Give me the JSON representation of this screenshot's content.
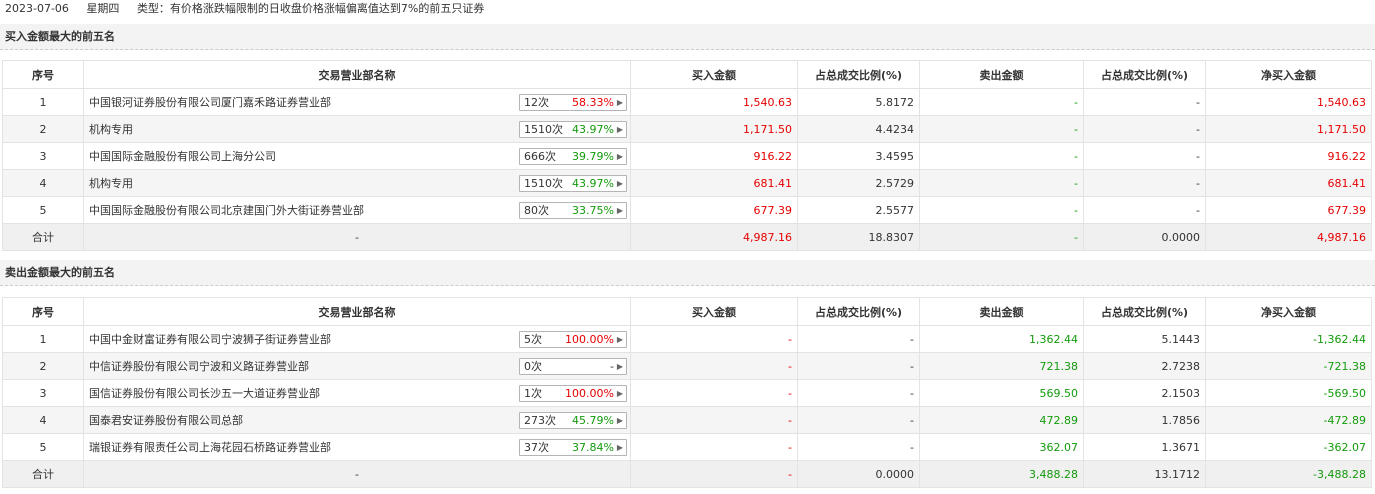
{
  "info": {
    "date": "2023-07-06",
    "weekday": "星期四",
    "type_text": "类型：有价格涨跌幅限制的日收盘价格涨幅偏离值达到7%的前五只证券"
  },
  "buy_section": {
    "title": "买入金额最大的前五名",
    "headers": [
      "序号",
      "交易营业部名称",
      "买入金额",
      "占总成交比例(%)",
      "卖出金额",
      "占总成交比例(%)",
      "净买入金额"
    ],
    "rows": [
      {
        "idx": "1",
        "name": "中国银河证券股份有限公司厦门嘉禾路证券营业部",
        "count": "12次",
        "rate": "58.33%",
        "rate_color": "red",
        "buy": "1,540.63",
        "buy_pct": "5.8172",
        "sell": "-",
        "sell_pct": "-",
        "net": "1,540.63"
      },
      {
        "idx": "2",
        "name": "机构专用",
        "count": "1510次",
        "rate": "43.97%",
        "rate_color": "green",
        "buy": "1,171.50",
        "buy_pct": "4.4234",
        "sell": "-",
        "sell_pct": "-",
        "net": "1,171.50"
      },
      {
        "idx": "3",
        "name": "中国国际金融股份有限公司上海分公司",
        "count": "666次",
        "rate": "39.79%",
        "rate_color": "green",
        "buy": "916.22",
        "buy_pct": "3.4595",
        "sell": "-",
        "sell_pct": "-",
        "net": "916.22"
      },
      {
        "idx": "4",
        "name": "机构专用",
        "count": "1510次",
        "rate": "43.97%",
        "rate_color": "green",
        "buy": "681.41",
        "buy_pct": "2.5729",
        "sell": "-",
        "sell_pct": "-",
        "net": "681.41"
      },
      {
        "idx": "5",
        "name": "中国国际金融股份有限公司北京建国门外大街证券营业部",
        "count": "80次",
        "rate": "33.75%",
        "rate_color": "green",
        "buy": "677.39",
        "buy_pct": "2.5577",
        "sell": "-",
        "sell_pct": "-",
        "net": "677.39"
      }
    ],
    "total": {
      "label": "合计",
      "name": "-",
      "buy": "4,987.16",
      "buy_pct": "18.8307",
      "sell": "-",
      "sell_pct": "0.0000",
      "net": "4,987.16"
    }
  },
  "sell_section": {
    "title": "卖出金额最大的前五名",
    "headers": [
      "序号",
      "交易营业部名称",
      "买入金额",
      "占总成交比例(%)",
      "卖出金额",
      "占总成交比例(%)",
      "净买入金额"
    ],
    "rows": [
      {
        "idx": "1",
        "name": "中国中金财富证券有限公司宁波狮子街证券营业部",
        "count": "5次",
        "rate": "100.00%",
        "rate_color": "red",
        "buy": "-",
        "buy_pct": "-",
        "sell": "1,362.44",
        "sell_pct": "5.1443",
        "net": "-1,362.44"
      },
      {
        "idx": "2",
        "name": "中信证券股份有限公司宁波和义路证券营业部",
        "count": "0次",
        "rate": "-",
        "rate_color": "gray",
        "buy": "-",
        "buy_pct": "-",
        "sell": "721.38",
        "sell_pct": "2.7238",
        "net": "-721.38"
      },
      {
        "idx": "3",
        "name": "国信证券股份有限公司长沙五一大道证券营业部",
        "count": "1次",
        "rate": "100.00%",
        "rate_color": "red",
        "buy": "-",
        "buy_pct": "-",
        "sell": "569.50",
        "sell_pct": "2.1503",
        "net": "-569.50"
      },
      {
        "idx": "4",
        "name": "国泰君安证券股份有限公司总部",
        "count": "273次",
        "rate": "45.79%",
        "rate_color": "green",
        "buy": "-",
        "buy_pct": "-",
        "sell": "472.89",
        "sell_pct": "1.7856",
        "net": "-472.89"
      },
      {
        "idx": "5",
        "name": "瑞银证券有限责任公司上海花园石桥路证券营业部",
        "count": "37次",
        "rate": "37.84%",
        "rate_color": "green",
        "buy": "-",
        "buy_pct": "-",
        "sell": "362.07",
        "sell_pct": "1.3671",
        "net": "-362.07"
      }
    ],
    "total": {
      "label": "合计",
      "name": "-",
      "buy": "-",
      "buy_pct": "0.0000",
      "sell": "3,488.28",
      "sell_pct": "13.1712",
      "net": "-3,488.28"
    }
  },
  "colors": {
    "red": "#e60000",
    "green": "#139b0b",
    "gray": "#333333"
  }
}
